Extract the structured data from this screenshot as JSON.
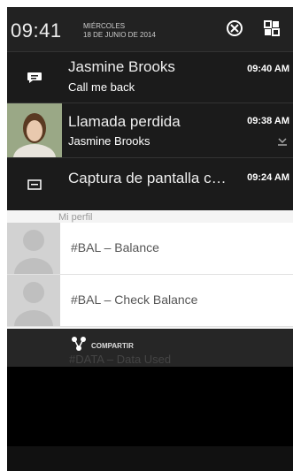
{
  "status": {
    "time": "09:41",
    "date_line1": "MIÉRCOLES",
    "date_line2": "18 DE JUNIO DE 2014"
  },
  "notifications": [
    {
      "icon": "chat-bubble-icon",
      "title": "Jasmine Brooks",
      "sub": "Call me back",
      "time": "09:40 AM"
    },
    {
      "icon": "contact-photo",
      "title": "Llamada perdida",
      "sub": "Jasmine Brooks",
      "time": "09:38 AM",
      "extra_icon": "missed-call-icon"
    },
    {
      "icon": "screenshot-icon",
      "title": "Captura de pantalla ca...",
      "time": "09:24 AM"
    }
  ],
  "list": {
    "partial_label": "Mi perfil",
    "rows": [
      {
        "label": "#BAL – Balance"
      },
      {
        "label": "#BAL – Check Balance"
      }
    ]
  },
  "share": {
    "label": "COMPARTIR",
    "ghost_text": "#DATA – Data Used"
  }
}
